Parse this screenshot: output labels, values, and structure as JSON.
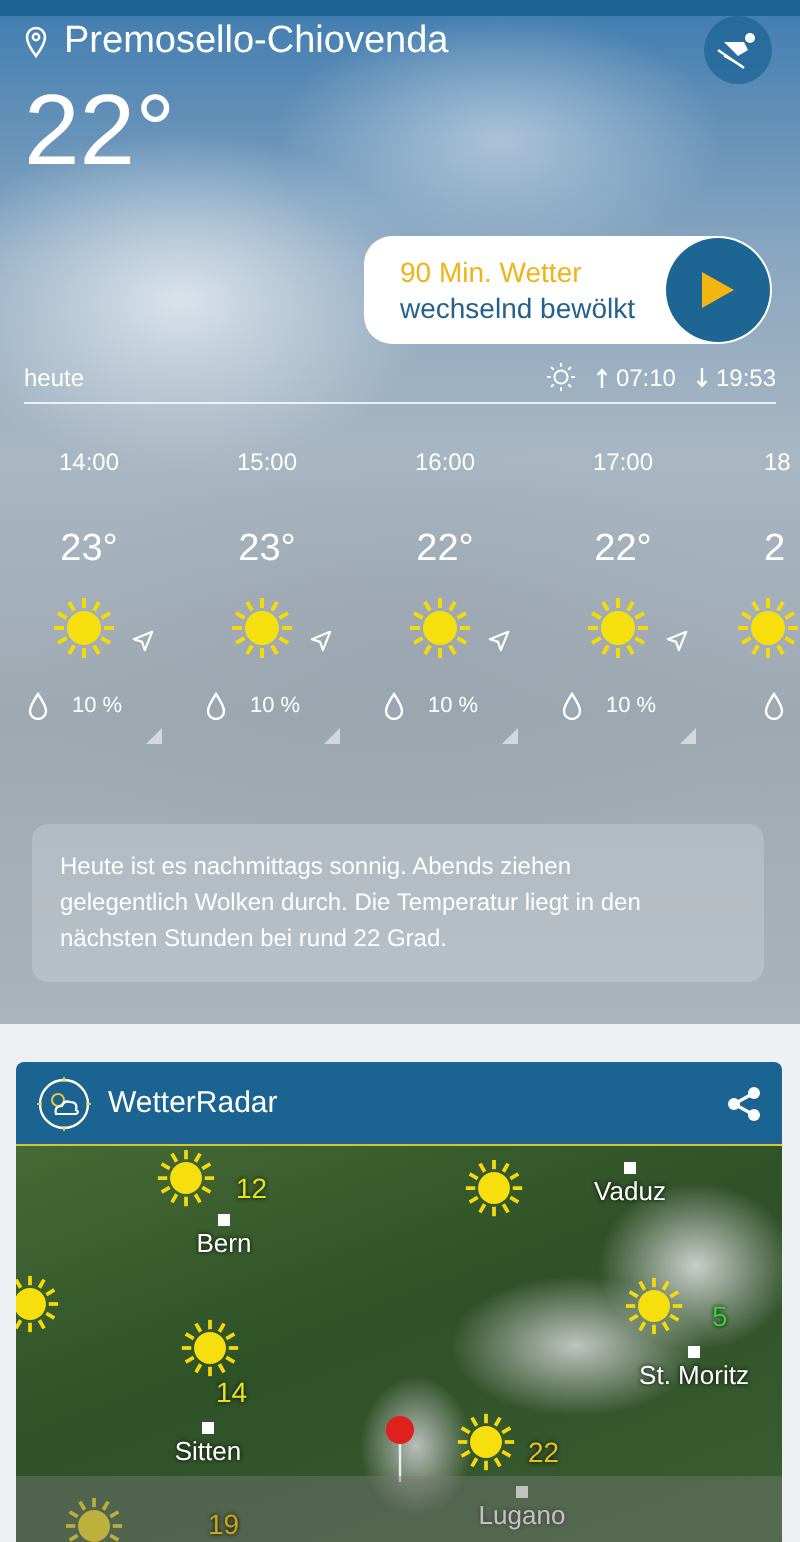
{
  "location": "Premosello-Chiovenda",
  "temperature": "22°",
  "nowcast": {
    "title": "90 Min. Wetter",
    "description": "wechselnd bewölkt"
  },
  "today": {
    "label": "heute",
    "sunrise": "07:10",
    "sunset": "19:53"
  },
  "hours": [
    {
      "time": "14:00",
      "temp": "23°",
      "precip": "10 %"
    },
    {
      "time": "15:00",
      "temp": "23°",
      "precip": "10 %"
    },
    {
      "time": "16:00",
      "temp": "22°",
      "precip": "10 %"
    },
    {
      "time": "17:00",
      "temp": "22°",
      "precip": "10 %"
    },
    {
      "time": "18",
      "temp": "2"
    }
  ],
  "summary": "Heute ist es nachmittags sonnig. Abends ziehen gelegentlich Wolken durch. Die Temperatur liegt in den nächsten Stunden bei rund 22 Grad.",
  "radar": {
    "title": "WetterRadar",
    "cities": [
      "Vaduz",
      "Bern",
      "St. Moritz",
      "Sitten",
      "Lugano"
    ],
    "temps": [
      {
        "value": "12",
        "color": "#e6e21c"
      },
      {
        "value": "5",
        "color": "#2fd62f"
      },
      {
        "value": "14",
        "color": "#e6e21c"
      },
      {
        "value": "22",
        "color": "#e6c21c"
      },
      {
        "value": "19",
        "color": "#c8a818"
      }
    ]
  }
}
